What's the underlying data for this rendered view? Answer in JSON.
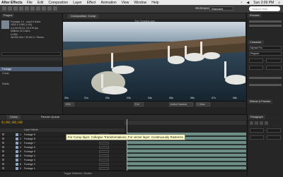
{
  "menubar": {
    "app_name": "After Effects",
    "items": [
      "File",
      "Edit",
      "Composition",
      "Layer",
      "Effect",
      "Animation",
      "View",
      "Window",
      "Help"
    ],
    "clock": "Sun 3:09 PM"
  },
  "toolbar": {
    "workspace_label": "Workspace:",
    "workspace_value": "Standard",
    "search_placeholder": "Search Help",
    "viewer_breadcrumb": "The Timeline.aep"
  },
  "project": {
    "tab_label": "Project",
    "info_lines": [
      "Footage 1 ▾ , used 6 times",
      "1920 x 1080 (1.00)",
      "Δ 0;00;05;01, 23.976 fps",
      "Millions of Colors",
      "H.264",
      "48.000 kHz / 32 bit U / Stereo"
    ],
    "selected_row": "Footage",
    "rows": [
      "Comp",
      "Solids"
    ]
  },
  "viewer": {
    "tab_label": "Composition: Comp",
    "ruler_ticks": [
      "00s",
      "01s",
      "02s",
      "03s",
      "04s",
      "05s",
      "06s",
      "07s",
      "08s"
    ],
    "controls": [
      "50%",
      "Full",
      "Active Camera",
      "1 View"
    ],
    "zoom": "50%"
  },
  "right_panel": {
    "tabs": [
      "Preview",
      "Character",
      "Effects & Presets"
    ],
    "font_label": "Myriad Pro",
    "style_label": "Regular"
  },
  "timeline": {
    "tab_label": "Comp",
    "tab2_label": "Render Queue",
    "timecode": "0;00;00;00",
    "column_header": "Layer Name",
    "layers": [
      {
        "num": "1",
        "name": "Footage 8"
      },
      {
        "num": "2",
        "name": "Footage 8"
      },
      {
        "num": "3",
        "name": "Footage 7"
      },
      {
        "num": "4",
        "name": "Footage 6"
      },
      {
        "num": "5",
        "name": "Footage 5"
      },
      {
        "num": "6",
        "name": "Footage 4"
      },
      {
        "num": "7",
        "name": "Footage 3"
      },
      {
        "num": "8",
        "name": "Footage 2"
      },
      {
        "num": "9",
        "name": "Footage 1"
      }
    ],
    "bottom_label": "Toggle Switches / Modes",
    "tooltip": "For Comp layer: Collapse Transformations; For vector layer: Continuously Rasterize"
  },
  "paragraph_panel": {
    "tab_label": "Paragraph"
  },
  "colors": {
    "playhead": "#d8a830",
    "layer_bar": "#6c8e84",
    "selection": "#4d5d73",
    "timecode": "#e7b600"
  }
}
